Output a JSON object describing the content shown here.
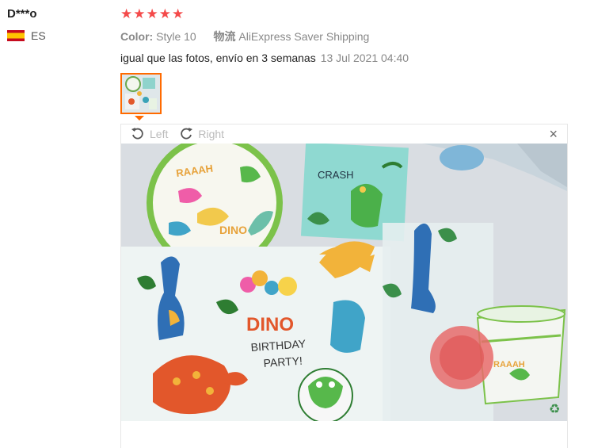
{
  "reviewer": {
    "name": "D***o",
    "country_code": "ES",
    "flag_colors": [
      "#c60b1e",
      "#ffc400"
    ]
  },
  "review": {
    "stars": "★★★★★",
    "rating": 5,
    "star_color": "#f44a4a",
    "color_label": "Color:",
    "color_value": "Style 10",
    "shipping_label": "物流",
    "shipping_value": "AliExpress Saver Shipping",
    "text": "igual que las fotos, envío en 3 semanas",
    "date": "13 Jul 2021 04:40"
  },
  "viewer": {
    "rotate_left": "Left",
    "rotate_right": "Right",
    "close_symbol": "×",
    "accent_color": "#ff6a00"
  },
  "photo": {
    "plate_text": "RAAAH",
    "plate_badge": "DINO",
    "napkin_text": "CRASH",
    "banner_text": "DINO",
    "party_text_1": "BIRTHDAY",
    "party_text_2": "PARTY!",
    "cup_text": "RAAAH"
  }
}
